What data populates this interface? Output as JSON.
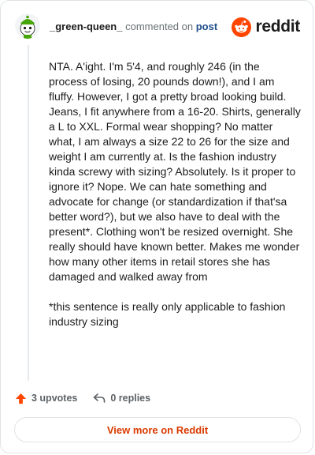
{
  "header": {
    "username": "_green-queen_",
    "commented_text": "commented on",
    "post_link": "post",
    "brand": "reddit"
  },
  "comment": {
    "paragraphs": [
      "NTA. A'ight. I'm 5'4, and roughly 246 (in the process of losing, 20 pounds down!), and I am fluffy. However, I got a pretty broad looking build. Jeans, I fit anywhere from a 16-20. Shirts, generally a L to XXL. Formal wear shopping? No matter what, I am always a size 22 to 26 for the size and weight I am currently at. Is the fashion industry kinda screwy with sizing? Absolutely. Is it proper to ignore it? Nope. We can hate something and advocate for change (or standardization if that'sa better word?), but we also have to deal with the present*. Clothing won't be resized overnight. She really should have known better. Makes me wonder how many other items in retail stores she has damaged and walked away from",
      "*this sentence is really only applicable to fashion industry sizing"
    ]
  },
  "actions": {
    "upvotes": "3 upvotes",
    "replies": "0 replies"
  },
  "footer": {
    "view_more": "View more on Reddit"
  },
  "colors": {
    "accent": "#d93a00",
    "reddit_orange": "#ff4500",
    "link": "#1f4e8c",
    "avatar_green": "#46a508"
  },
  "icons": [
    "snoo-avatar",
    "reddit-logo-icon",
    "upvote-arrow-icon",
    "reply-icon"
  ]
}
